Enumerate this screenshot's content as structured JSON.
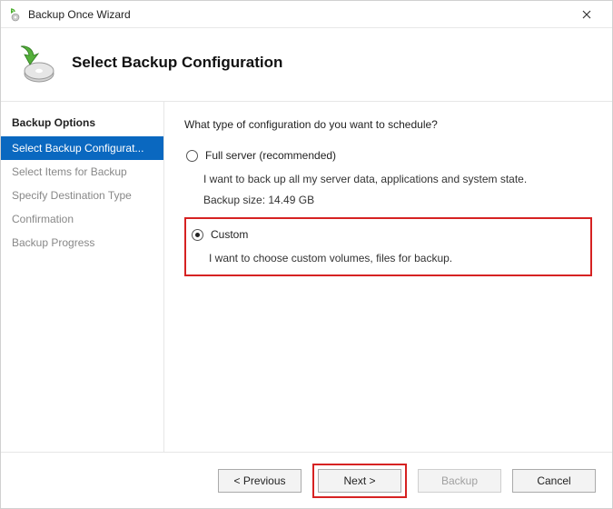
{
  "window": {
    "title": "Backup Once Wizard"
  },
  "header": {
    "title": "Select Backup Configuration"
  },
  "sidebar": {
    "heading": "Backup Options",
    "steps": [
      {
        "label": "Select Backup Configurat...",
        "state": "selected"
      },
      {
        "label": "Select Items for Backup",
        "state": "future"
      },
      {
        "label": "Specify Destination Type",
        "state": "future"
      },
      {
        "label": "Confirmation",
        "state": "future"
      },
      {
        "label": "Backup Progress",
        "state": "future"
      }
    ]
  },
  "content": {
    "question": "What type of configuration do you want to schedule?",
    "options": [
      {
        "id": "full",
        "title": "Full server (recommended)",
        "desc": "I want to back up all my server data, applications and system state.",
        "extra": "Backup size: 14.49 GB",
        "checked": false
      },
      {
        "id": "custom",
        "title": "Custom",
        "desc": "I want to choose custom volumes, files for backup.",
        "extra": "",
        "checked": true
      }
    ]
  },
  "footer": {
    "previous": "< Previous",
    "next": "Next >",
    "backup": "Backup",
    "cancel": "Cancel"
  }
}
